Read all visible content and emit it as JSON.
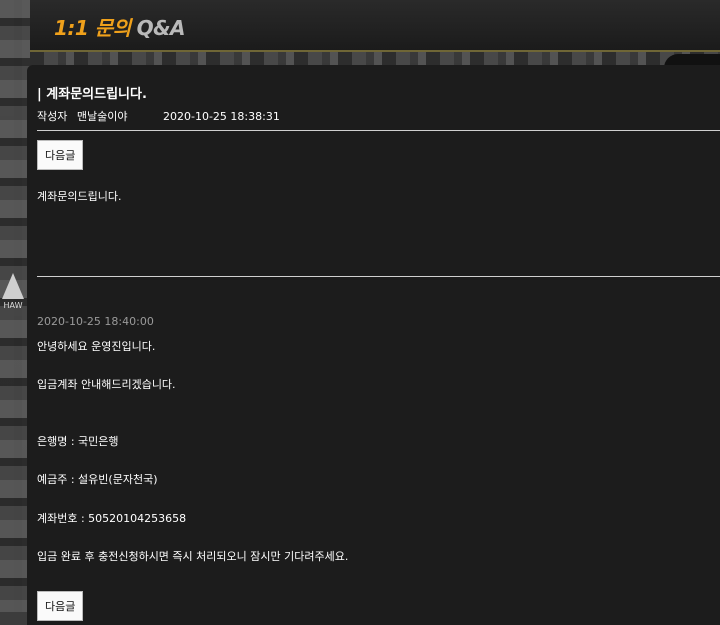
{
  "header": {
    "title_ko": "1:1 문의",
    "title_en": "Q&A"
  },
  "side_logo": {
    "text": "HAW"
  },
  "post": {
    "title": "| 계좌문의드립니다.",
    "author_label": "작성자",
    "author_name": "맨날술이야",
    "datetime": "2020-10-25 18:38:31",
    "next_button": "다음글",
    "content": "계좌문의드립니다."
  },
  "reply": {
    "datetime": "2020-10-25 18:40:00",
    "lines": [
      "안녕하세요 운영진입니다.",
      "입금계좌 안내해드리겠습니다.",
      "은행명 : 국민은행",
      "예금주 : 설유빈(문자천국)",
      "계좌번호 : 50520104253658",
      "입금 완료 후 충전신청하시면 즉시 처리되오니 잠시만 기다려주세요."
    ],
    "next_button": "다음글"
  }
}
